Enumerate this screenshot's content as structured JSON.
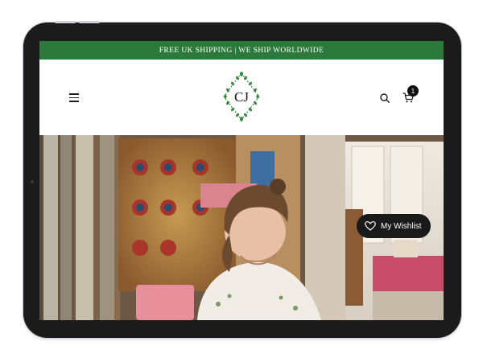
{
  "announcement": {
    "text": "FREE UK SHIPPING | WE SHIP WORLDWIDE"
  },
  "logo": {
    "monogram": "CJ"
  },
  "header": {
    "cart_count": "1"
  },
  "wishlist": {
    "label": "My Wishlist"
  },
  "colors": {
    "announcement_bg": "#2b7a3c",
    "device_frame": "#1b1b1b",
    "wishlist_bg": "#1a1a1a"
  },
  "icons": [
    "hamburger-menu-icon",
    "search-icon",
    "cart-icon",
    "heart-icon"
  ]
}
